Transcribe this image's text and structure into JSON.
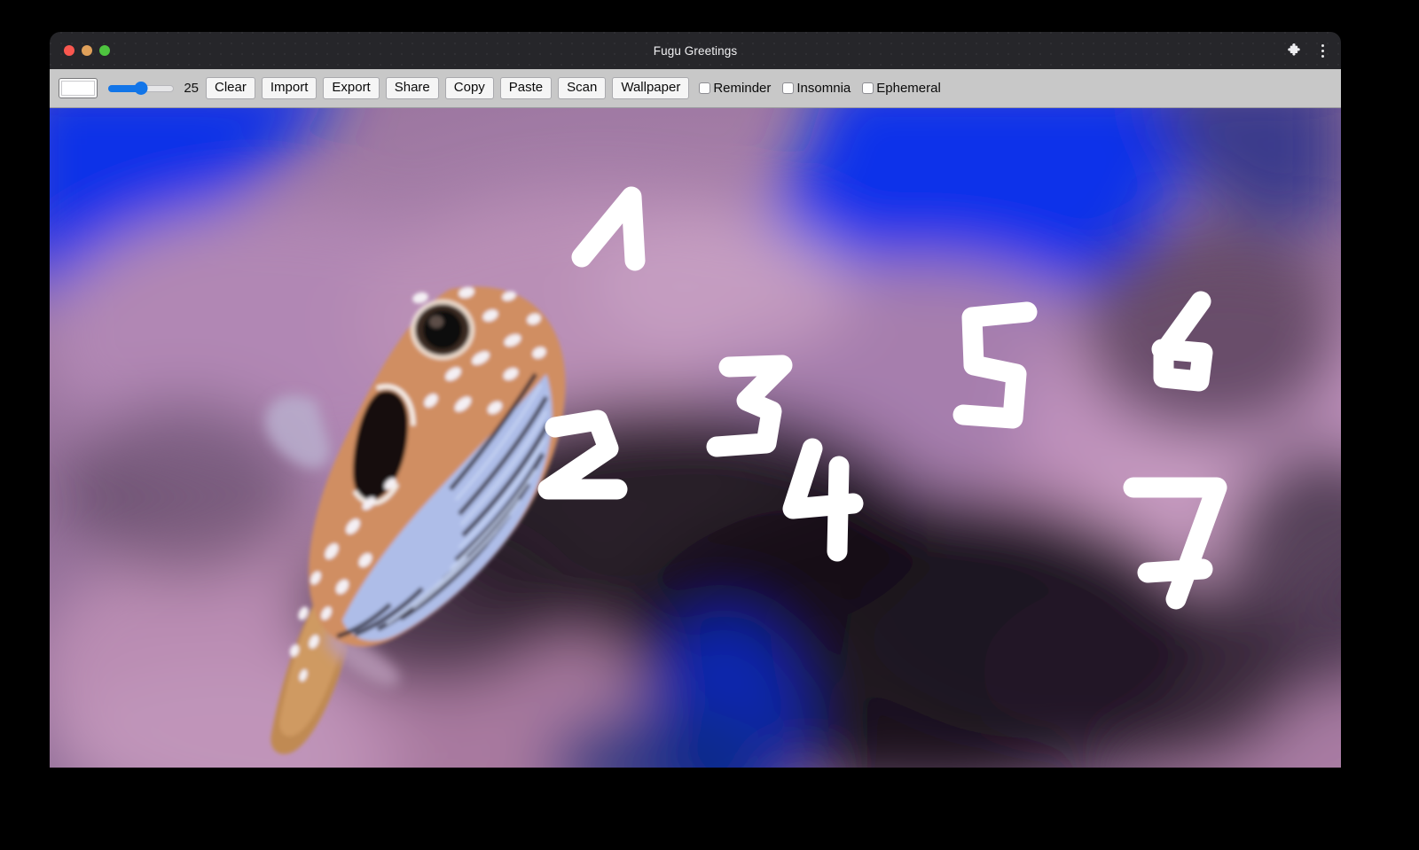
{
  "window": {
    "title": "Fugu Greetings",
    "traffic_lights": [
      "close",
      "minimize",
      "maximize"
    ],
    "right_icons": [
      {
        "name": "extensions-icon",
        "glyph": "puzzle-piece"
      },
      {
        "name": "browser-menu-icon",
        "glyph": "three-dot-vertical"
      }
    ]
  },
  "toolbar": {
    "color_picker": {
      "name": "color-swatch",
      "value": "#ffffff"
    },
    "slider": {
      "name": "line-width-slider",
      "value": 25,
      "min": 0,
      "max": 50,
      "percent": 50,
      "fill_color": "#1275e8"
    },
    "slider_value_label": "25",
    "buttons": [
      {
        "label": "Clear",
        "name": "clear-button"
      },
      {
        "label": "Import",
        "name": "import-button"
      },
      {
        "label": "Export",
        "name": "export-button"
      },
      {
        "label": "Share",
        "name": "share-button"
      },
      {
        "label": "Copy",
        "name": "copy-button"
      },
      {
        "label": "Paste",
        "name": "paste-button"
      },
      {
        "label": "Scan",
        "name": "scan-button"
      },
      {
        "label": "Wallpaper",
        "name": "wallpaper-button"
      }
    ],
    "checkboxes": [
      {
        "label": "Reminder",
        "name": "reminder-checkbox",
        "checked": false
      },
      {
        "label": "Insomnia",
        "name": "insomnia-checkbox",
        "checked": false
      },
      {
        "label": "Ephemeral",
        "name": "ephemeral-checkbox",
        "checked": false
      }
    ]
  },
  "canvas": {
    "name": "drawing-canvas",
    "background_description": "Blurred underwater photo of a spotted pufferfish (fugu) over pink-purple coral with bright blue water patches",
    "ink_color": "#ffffff",
    "stroke_width": 25,
    "drawn_digits": [
      {
        "value": "1",
        "name": "ink-digit-1"
      },
      {
        "value": "2",
        "name": "ink-digit-2"
      },
      {
        "value": "3",
        "name": "ink-digit-3"
      },
      {
        "value": "4",
        "name": "ink-digit-4"
      },
      {
        "value": "5",
        "name": "ink-digit-5"
      },
      {
        "value": "6",
        "name": "ink-digit-6"
      },
      {
        "value": "7",
        "name": "ink-digit-7"
      }
    ],
    "palette": {
      "blue": "#1030e8",
      "deep_blue": "#0a2ab8",
      "mauve": "#a87ba8",
      "pink": "#c79ac0",
      "dark": "#140d18",
      "fish_orange": "#d78f63",
      "fish_stripe": "#b9c8ee"
    }
  }
}
